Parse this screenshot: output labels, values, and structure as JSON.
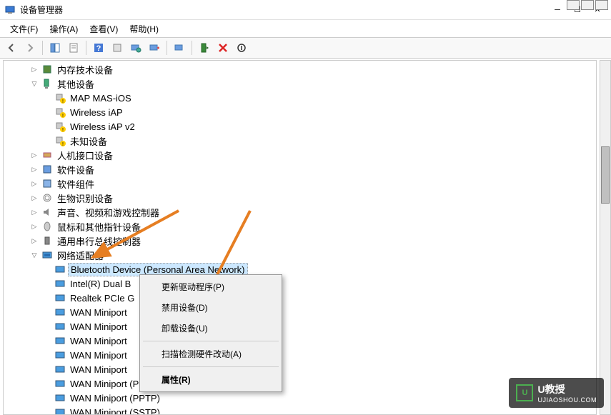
{
  "window": {
    "title": "设备管理器"
  },
  "menus": {
    "file": "文件(F)",
    "action": "操作(A)",
    "view": "查看(V)",
    "help": "帮助(H)"
  },
  "tree": {
    "memory_tech": "内存技术设备",
    "other_devices": "其他设备",
    "other_children": {
      "map_mas": "MAP MAS-iOS",
      "wireless_iap": "Wireless iAP",
      "wireless_iap_v2": "Wireless iAP v2",
      "unknown": "未知设备"
    },
    "hid": "人机接口设备",
    "software_devices": "软件设备",
    "software_components": "软件组件",
    "biometric": "生物识别设备",
    "sound": "声音、视频和游戏控制器",
    "mouse": "鼠标和其他指针设备",
    "usb": "通用串行总线控制器",
    "network": "网络适配器",
    "network_children": {
      "bluetooth": "Bluetooth Device (Personal Area Network)",
      "intel": "Intel(R) Dual B",
      "realtek": "Realtek PCIe G",
      "wan1": "WAN Miniport",
      "wan2": "WAN Miniport",
      "wan3": "WAN Miniport",
      "wan4": "WAN Miniport",
      "wan5": "WAN Miniport",
      "wan_pppoe": "WAN Miniport (PPPOE)",
      "wan_pptp": "WAN Miniport (PPTP)",
      "wan_sstp": "WAN Miniport (SSTP)"
    }
  },
  "context_menu": {
    "update_driver": "更新驱动程序(P)",
    "disable": "禁用设备(D)",
    "uninstall": "卸载设备(U)",
    "scan": "扫描检测硬件改动(A)",
    "properties": "属性(R)"
  },
  "watermark": {
    "brand": "U教授",
    "url": "UJIAOSHOU.COM"
  }
}
